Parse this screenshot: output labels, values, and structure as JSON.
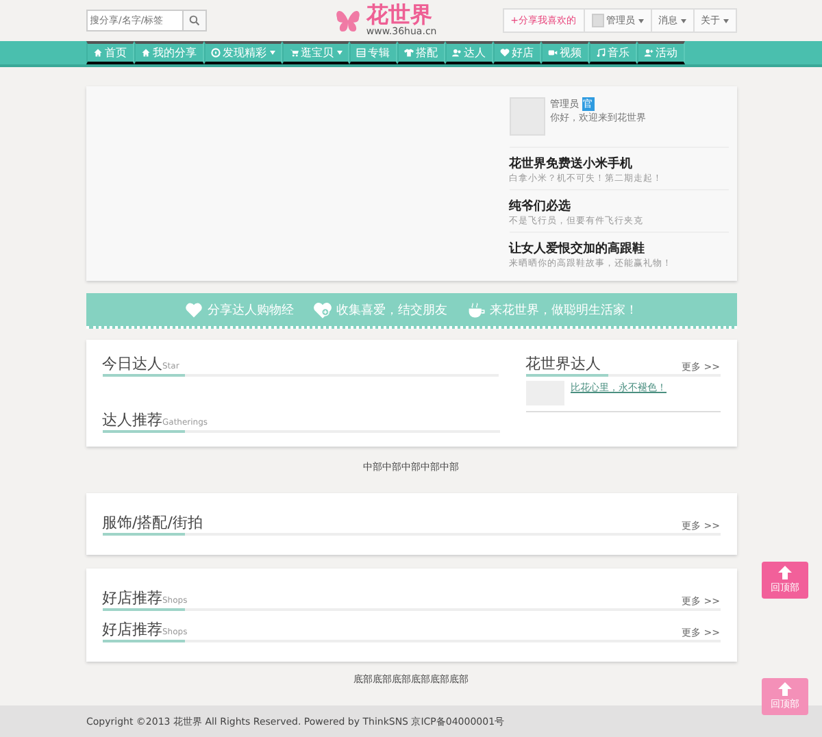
{
  "header": {
    "search": {
      "placeholder": "搜分享/名字/标签"
    },
    "logo": {
      "name": "花世界",
      "url": "www.36hua.cn"
    },
    "actions": [
      {
        "kind": "share",
        "label": "+分享我喜欢的",
        "dropdown": false
      },
      {
        "kind": "user",
        "label": "管理员",
        "dropdown": true
      },
      {
        "kind": "plain",
        "label": "消息",
        "dropdown": true
      },
      {
        "kind": "plain",
        "label": "关于",
        "dropdown": true
      }
    ]
  },
  "nav": [
    {
      "label": "首页",
      "dropdown": false
    },
    {
      "label": "我的分享",
      "dropdown": false
    },
    {
      "label": "发现精彩",
      "dropdown": true
    },
    {
      "label": "逛宝贝",
      "dropdown": true
    },
    {
      "label": "专辑",
      "dropdown": false
    },
    {
      "label": "搭配",
      "dropdown": false
    },
    {
      "label": "达人",
      "dropdown": false
    },
    {
      "label": "好店",
      "dropdown": false
    },
    {
      "label": "视频",
      "dropdown": false
    },
    {
      "label": "音乐",
      "dropdown": false
    },
    {
      "label": "活动",
      "dropdown": false
    }
  ],
  "hero": {
    "user": {
      "name": "管理员",
      "badge": "官",
      "greeting": "你好，欢迎来到花世界"
    },
    "articles": [
      {
        "title": "花世界免费送小米手机",
        "summary": "白拿小米？机不可失！第二期走起！"
      },
      {
        "title": "纯爷们必选",
        "summary": "不是飞行员，但要有件飞行夹克"
      },
      {
        "title": "让女人爱恨交加的高跟鞋",
        "summary": "来晒晒你的高跟鞋故事，还能赢礼物！"
      }
    ]
  },
  "banner": [
    {
      "text": "分享达人购物经"
    },
    {
      "text": "收集喜爱，结交朋友"
    },
    {
      "text": "来花世界，做聪明生活家！"
    }
  ],
  "experts_card": {
    "today": {
      "title": "今日达人",
      "subtitle": "Star"
    },
    "world": {
      "title": "花世界达人",
      "more": "更多 >>",
      "entries": [
        {
          "text": "比花心里，永不褪色！"
        }
      ]
    },
    "recommend": {
      "title": "达人推荐",
      "subtitle": "Gatherings"
    }
  },
  "middle_text": "中部中部中部中部中部",
  "sections": [
    {
      "headers": [
        {
          "title": "服饰/搭配/街拍",
          "more": "更多 >>"
        }
      ]
    },
    {
      "headers": [
        {
          "title": "好店推荐",
          "subtitle": "Shops",
          "more": "更多 >>"
        },
        {
          "title": "好店推荐",
          "subtitle": "Shops",
          "more": "更多 >>"
        }
      ]
    }
  ],
  "bottom_text": "底部底部底部底部底部底部",
  "footer": "Copyright ©2013 花世界 All Rights Reserved. Powered by ThinkSNS  京ICP备04000001号",
  "back_to_top": [
    {
      "label": "回顶部",
      "disabled": false
    },
    {
      "label": "回顶部",
      "disabled": true
    }
  ]
}
